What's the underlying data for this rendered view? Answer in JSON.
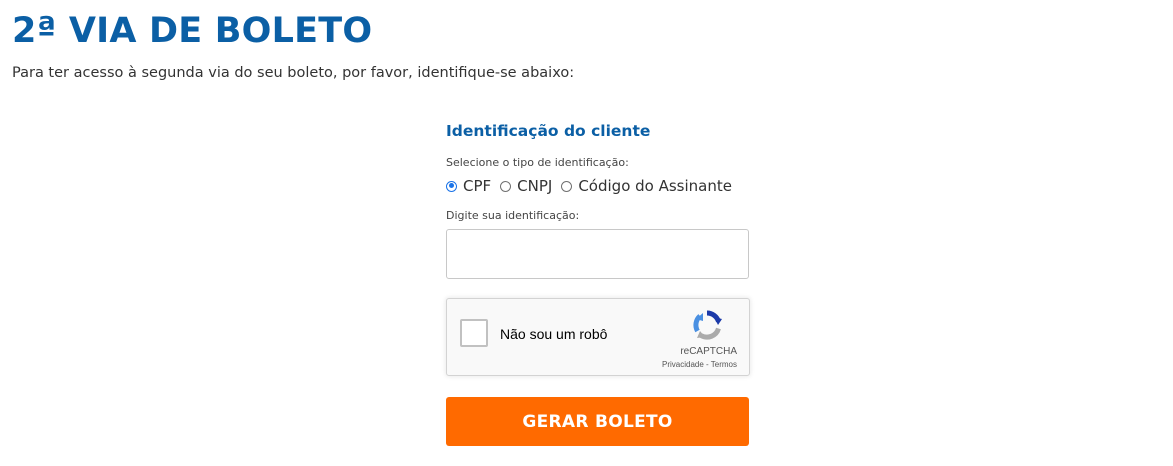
{
  "page": {
    "title": "2ª VIA DE BOLETO",
    "intro": "Para ter acesso à segunda via do seu boleto, por favor, identifique-se abaixo:"
  },
  "form": {
    "section_title": "Identificação do cliente",
    "type_label": "Selecione o tipo de identificação:",
    "id_types": [
      {
        "label": "CPF",
        "checked": true
      },
      {
        "label": "CNPJ",
        "checked": false
      },
      {
        "label": "Código do Assinante",
        "checked": false
      }
    ],
    "id_label": "Digite sua identificação:",
    "id_value": "",
    "submit_label": "GERAR BOLETO"
  },
  "recaptcha": {
    "label": "Não sou um robô",
    "brand": "reCAPTCHA",
    "privacy": "Privacidade",
    "separator": " - ",
    "terms": "Termos",
    "icon": "recaptcha-logo-icon"
  },
  "colors": {
    "title": "#0b5fa5",
    "button": "#ff6a00",
    "radio_checked": "#1a73e8"
  }
}
